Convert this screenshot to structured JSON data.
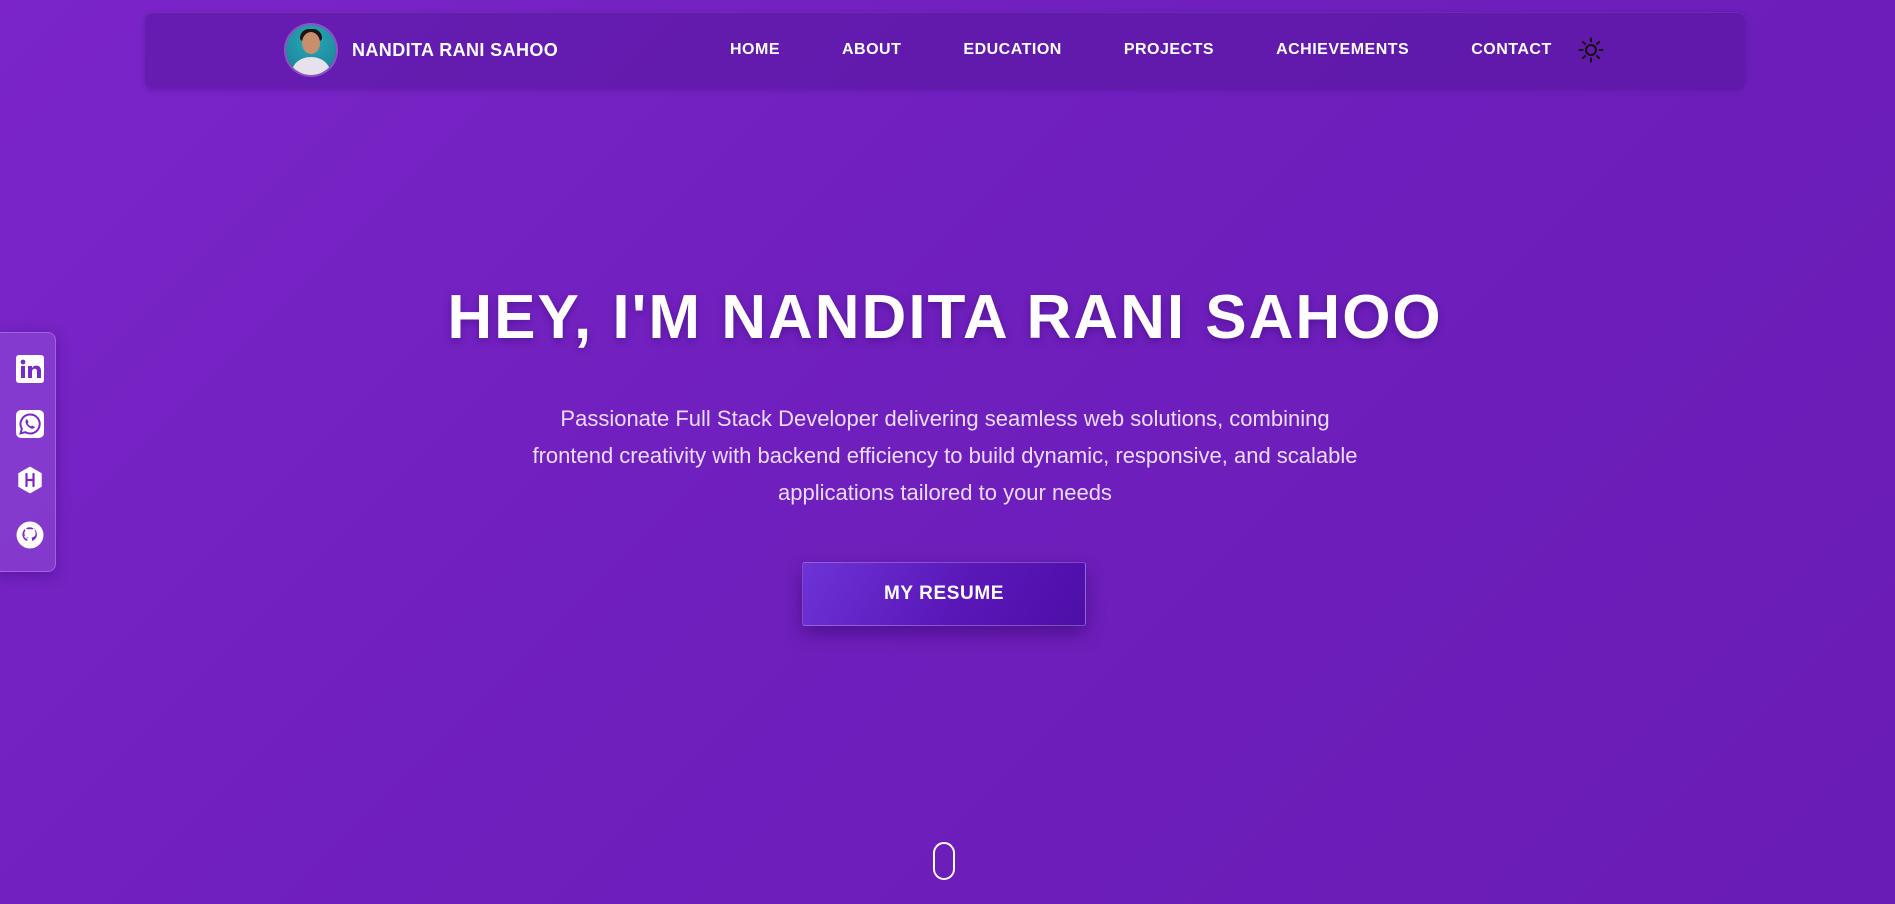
{
  "nav": {
    "brand_name": "NANDITA RANI SAHOO",
    "links": [
      "HOME",
      "ABOUT",
      "EDUCATION",
      "PROJECTS",
      "ACHIEVEMENTS",
      "CONTACT"
    ],
    "theme_icon": "sun-icon"
  },
  "social": {
    "icons": [
      "linkedin-icon",
      "whatsapp-icon",
      "hashnode-icon",
      "github-icon"
    ]
  },
  "hero": {
    "title": "HEY, I'M NANDITA RANI SAHOO",
    "description": "Passionate Full Stack Developer delivering seamless web solutions, combining frontend creativity with backend efficiency to build dynamic, responsive, and scalable applications tailored to your needs",
    "button_label": "MY RESUME"
  },
  "colors": {
    "background": "#7022c0",
    "navbar": "#5a1b9e",
    "text": "#ffffff",
    "button": "#5a17b8"
  }
}
